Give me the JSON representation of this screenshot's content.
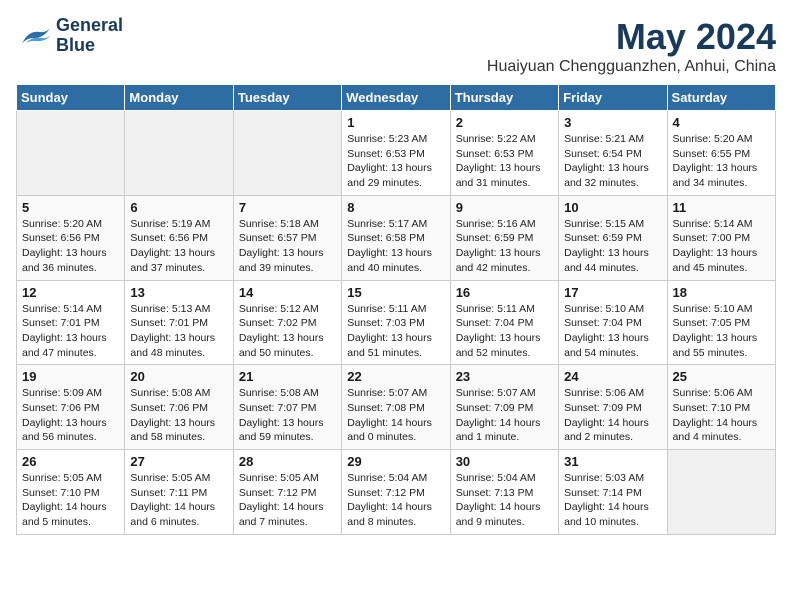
{
  "logo": {
    "line1": "General",
    "line2": "Blue"
  },
  "title": "May 2024",
  "subtitle": "Huaiyuan Chengguanzhen, Anhui, China",
  "days_of_week": [
    "Sunday",
    "Monday",
    "Tuesday",
    "Wednesday",
    "Thursday",
    "Friday",
    "Saturday"
  ],
  "weeks": [
    [
      {
        "day": "",
        "empty": true
      },
      {
        "day": "",
        "empty": true
      },
      {
        "day": "",
        "empty": true
      },
      {
        "day": "1",
        "sunrise": "Sunrise: 5:23 AM",
        "sunset": "Sunset: 6:53 PM",
        "daylight": "Daylight: 13 hours and 29 minutes."
      },
      {
        "day": "2",
        "sunrise": "Sunrise: 5:22 AM",
        "sunset": "Sunset: 6:53 PM",
        "daylight": "Daylight: 13 hours and 31 minutes."
      },
      {
        "day": "3",
        "sunrise": "Sunrise: 5:21 AM",
        "sunset": "Sunset: 6:54 PM",
        "daylight": "Daylight: 13 hours and 32 minutes."
      },
      {
        "day": "4",
        "sunrise": "Sunrise: 5:20 AM",
        "sunset": "Sunset: 6:55 PM",
        "daylight": "Daylight: 13 hours and 34 minutes."
      }
    ],
    [
      {
        "day": "5",
        "sunrise": "Sunrise: 5:20 AM",
        "sunset": "Sunset: 6:56 PM",
        "daylight": "Daylight: 13 hours and 36 minutes."
      },
      {
        "day": "6",
        "sunrise": "Sunrise: 5:19 AM",
        "sunset": "Sunset: 6:56 PM",
        "daylight": "Daylight: 13 hours and 37 minutes."
      },
      {
        "day": "7",
        "sunrise": "Sunrise: 5:18 AM",
        "sunset": "Sunset: 6:57 PM",
        "daylight": "Daylight: 13 hours and 39 minutes."
      },
      {
        "day": "8",
        "sunrise": "Sunrise: 5:17 AM",
        "sunset": "Sunset: 6:58 PM",
        "daylight": "Daylight: 13 hours and 40 minutes."
      },
      {
        "day": "9",
        "sunrise": "Sunrise: 5:16 AM",
        "sunset": "Sunset: 6:59 PM",
        "daylight": "Daylight: 13 hours and 42 minutes."
      },
      {
        "day": "10",
        "sunrise": "Sunrise: 5:15 AM",
        "sunset": "Sunset: 6:59 PM",
        "daylight": "Daylight: 13 hours and 44 minutes."
      },
      {
        "day": "11",
        "sunrise": "Sunrise: 5:14 AM",
        "sunset": "Sunset: 7:00 PM",
        "daylight": "Daylight: 13 hours and 45 minutes."
      }
    ],
    [
      {
        "day": "12",
        "sunrise": "Sunrise: 5:14 AM",
        "sunset": "Sunset: 7:01 PM",
        "daylight": "Daylight: 13 hours and 47 minutes."
      },
      {
        "day": "13",
        "sunrise": "Sunrise: 5:13 AM",
        "sunset": "Sunset: 7:01 PM",
        "daylight": "Daylight: 13 hours and 48 minutes."
      },
      {
        "day": "14",
        "sunrise": "Sunrise: 5:12 AM",
        "sunset": "Sunset: 7:02 PM",
        "daylight": "Daylight: 13 hours and 50 minutes."
      },
      {
        "day": "15",
        "sunrise": "Sunrise: 5:11 AM",
        "sunset": "Sunset: 7:03 PM",
        "daylight": "Daylight: 13 hours and 51 minutes."
      },
      {
        "day": "16",
        "sunrise": "Sunrise: 5:11 AM",
        "sunset": "Sunset: 7:04 PM",
        "daylight": "Daylight: 13 hours and 52 minutes."
      },
      {
        "day": "17",
        "sunrise": "Sunrise: 5:10 AM",
        "sunset": "Sunset: 7:04 PM",
        "daylight": "Daylight: 13 hours and 54 minutes."
      },
      {
        "day": "18",
        "sunrise": "Sunrise: 5:10 AM",
        "sunset": "Sunset: 7:05 PM",
        "daylight": "Daylight: 13 hours and 55 minutes."
      }
    ],
    [
      {
        "day": "19",
        "sunrise": "Sunrise: 5:09 AM",
        "sunset": "Sunset: 7:06 PM",
        "daylight": "Daylight: 13 hours and 56 minutes."
      },
      {
        "day": "20",
        "sunrise": "Sunrise: 5:08 AM",
        "sunset": "Sunset: 7:06 PM",
        "daylight": "Daylight: 13 hours and 58 minutes."
      },
      {
        "day": "21",
        "sunrise": "Sunrise: 5:08 AM",
        "sunset": "Sunset: 7:07 PM",
        "daylight": "Daylight: 13 hours and 59 minutes."
      },
      {
        "day": "22",
        "sunrise": "Sunrise: 5:07 AM",
        "sunset": "Sunset: 7:08 PM",
        "daylight": "Daylight: 14 hours and 0 minutes."
      },
      {
        "day": "23",
        "sunrise": "Sunrise: 5:07 AM",
        "sunset": "Sunset: 7:09 PM",
        "daylight": "Daylight: 14 hours and 1 minute."
      },
      {
        "day": "24",
        "sunrise": "Sunrise: 5:06 AM",
        "sunset": "Sunset: 7:09 PM",
        "daylight": "Daylight: 14 hours and 2 minutes."
      },
      {
        "day": "25",
        "sunrise": "Sunrise: 5:06 AM",
        "sunset": "Sunset: 7:10 PM",
        "daylight": "Daylight: 14 hours and 4 minutes."
      }
    ],
    [
      {
        "day": "26",
        "sunrise": "Sunrise: 5:05 AM",
        "sunset": "Sunset: 7:10 PM",
        "daylight": "Daylight: 14 hours and 5 minutes."
      },
      {
        "day": "27",
        "sunrise": "Sunrise: 5:05 AM",
        "sunset": "Sunset: 7:11 PM",
        "daylight": "Daylight: 14 hours and 6 minutes."
      },
      {
        "day": "28",
        "sunrise": "Sunrise: 5:05 AM",
        "sunset": "Sunset: 7:12 PM",
        "daylight": "Daylight: 14 hours and 7 minutes."
      },
      {
        "day": "29",
        "sunrise": "Sunrise: 5:04 AM",
        "sunset": "Sunset: 7:12 PM",
        "daylight": "Daylight: 14 hours and 8 minutes."
      },
      {
        "day": "30",
        "sunrise": "Sunrise: 5:04 AM",
        "sunset": "Sunset: 7:13 PM",
        "daylight": "Daylight: 14 hours and 9 minutes."
      },
      {
        "day": "31",
        "sunrise": "Sunrise: 5:03 AM",
        "sunset": "Sunset: 7:14 PM",
        "daylight": "Daylight: 14 hours and 10 minutes."
      },
      {
        "day": "",
        "empty": true
      }
    ]
  ]
}
